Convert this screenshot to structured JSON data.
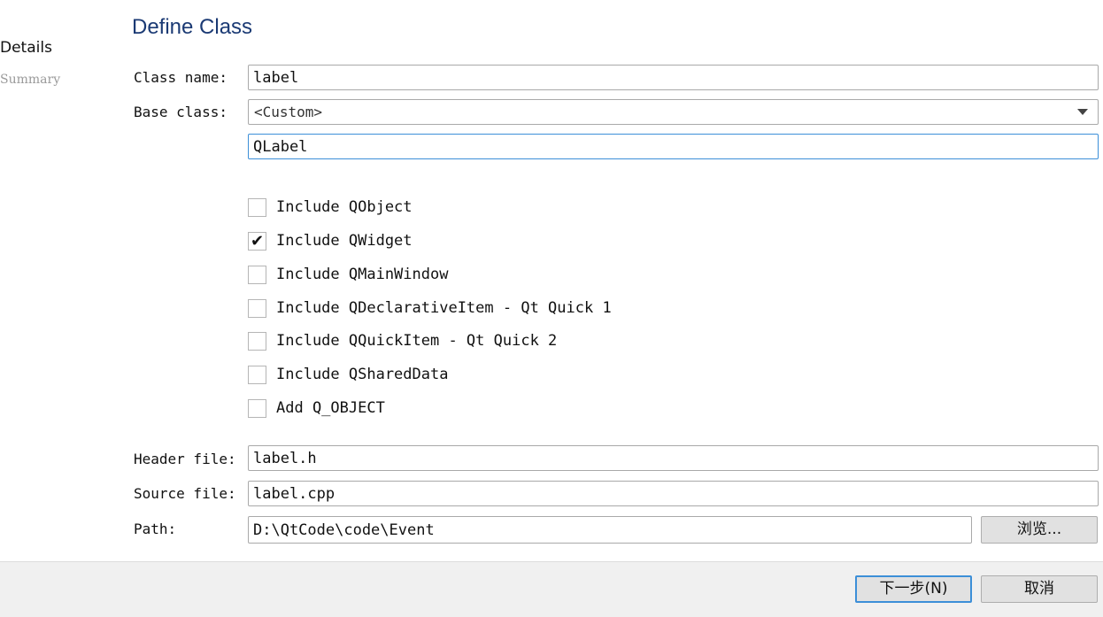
{
  "sidebar": {
    "details": "Details",
    "summary": "Summary"
  },
  "page": {
    "title": "Define Class"
  },
  "form": {
    "class_name_label": "Class name:",
    "class_name_value": "label",
    "base_class_label": "Base class:",
    "base_class_selected": "<Custom>",
    "custom_base_value": "QLabel",
    "header_file_label": "Header file:",
    "header_file_value": "label.h",
    "source_file_label": "Source file:",
    "source_file_value": "label.cpp",
    "path_label": "Path:",
    "path_value": "D:\\QtCode\\code\\Event",
    "browse_label": "浏览..."
  },
  "options": [
    {
      "label": "Include QObject",
      "checked": false,
      "mark": ""
    },
    {
      "label": "Include QWidget",
      "checked": true,
      "mark": "✔"
    },
    {
      "label": "Include QMainWindow",
      "checked": false,
      "mark": ""
    },
    {
      "label": "Include QDeclarativeItem - Qt Quick 1",
      "checked": false,
      "mark": ""
    },
    {
      "label": "Include QQuickItem - Qt Quick 2",
      "checked": false,
      "mark": ""
    },
    {
      "label": "Include QSharedData",
      "checked": false,
      "mark": ""
    },
    {
      "label": "Add Q_OBJECT",
      "checked": false,
      "mark": ""
    }
  ],
  "footer": {
    "next_label": "下一步(N)",
    "cancel_label": "取消"
  }
}
